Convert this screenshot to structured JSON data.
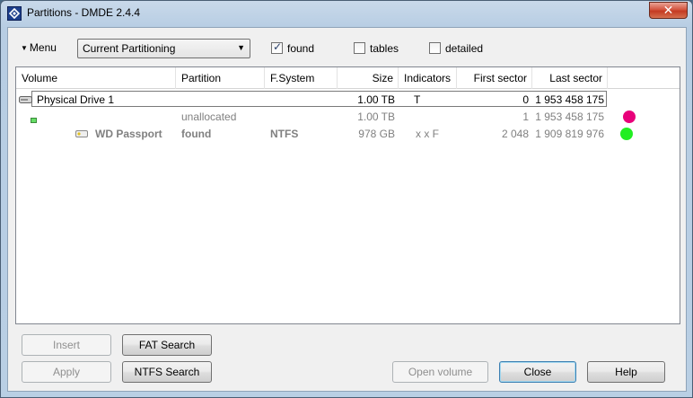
{
  "window": {
    "title": "Partitions - DMDE 2.4.4",
    "close_glyph": "✕"
  },
  "toolbar": {
    "menu_label": "Menu",
    "view_select": "Current Partitioning",
    "checkboxes": [
      {
        "label": "found",
        "checked": true
      },
      {
        "label": "tables",
        "checked": false
      },
      {
        "label": "detailed",
        "checked": false
      }
    ]
  },
  "table": {
    "columns": [
      "Volume",
      "Partition",
      "F.System",
      "Size",
      "Indicators",
      "First sector",
      "Last sector"
    ],
    "rows": [
      {
        "volume": "Physical Drive 1",
        "partition": "",
        "fs": "",
        "size": "1.00 TB",
        "indicators": "T",
        "first": "0",
        "last": "1 953 458 175",
        "icon": "disk-drive-icon",
        "status_color": ""
      },
      {
        "volume": "",
        "partition": "unallocated",
        "fs": "",
        "size": "1.00 TB",
        "indicators": "",
        "first": "1",
        "last": "1 953 458 175",
        "icon": "unallocated-icon",
        "status_color": "#e8007a"
      },
      {
        "volume": "WD Passport",
        "partition": "found",
        "fs": "NTFS",
        "size": "978 GB",
        "indicators": "x x F",
        "first": "2 048",
        "last": "1 909 819 976",
        "icon": "volume-icon",
        "status_color": "#22ee22"
      }
    ]
  },
  "buttons": {
    "insert": "Insert",
    "apply": "Apply",
    "fat_search": "FAT Search",
    "ntfs_search": "NTFS Search",
    "open_volume": "Open volume",
    "close": "Close",
    "help": "Help"
  }
}
